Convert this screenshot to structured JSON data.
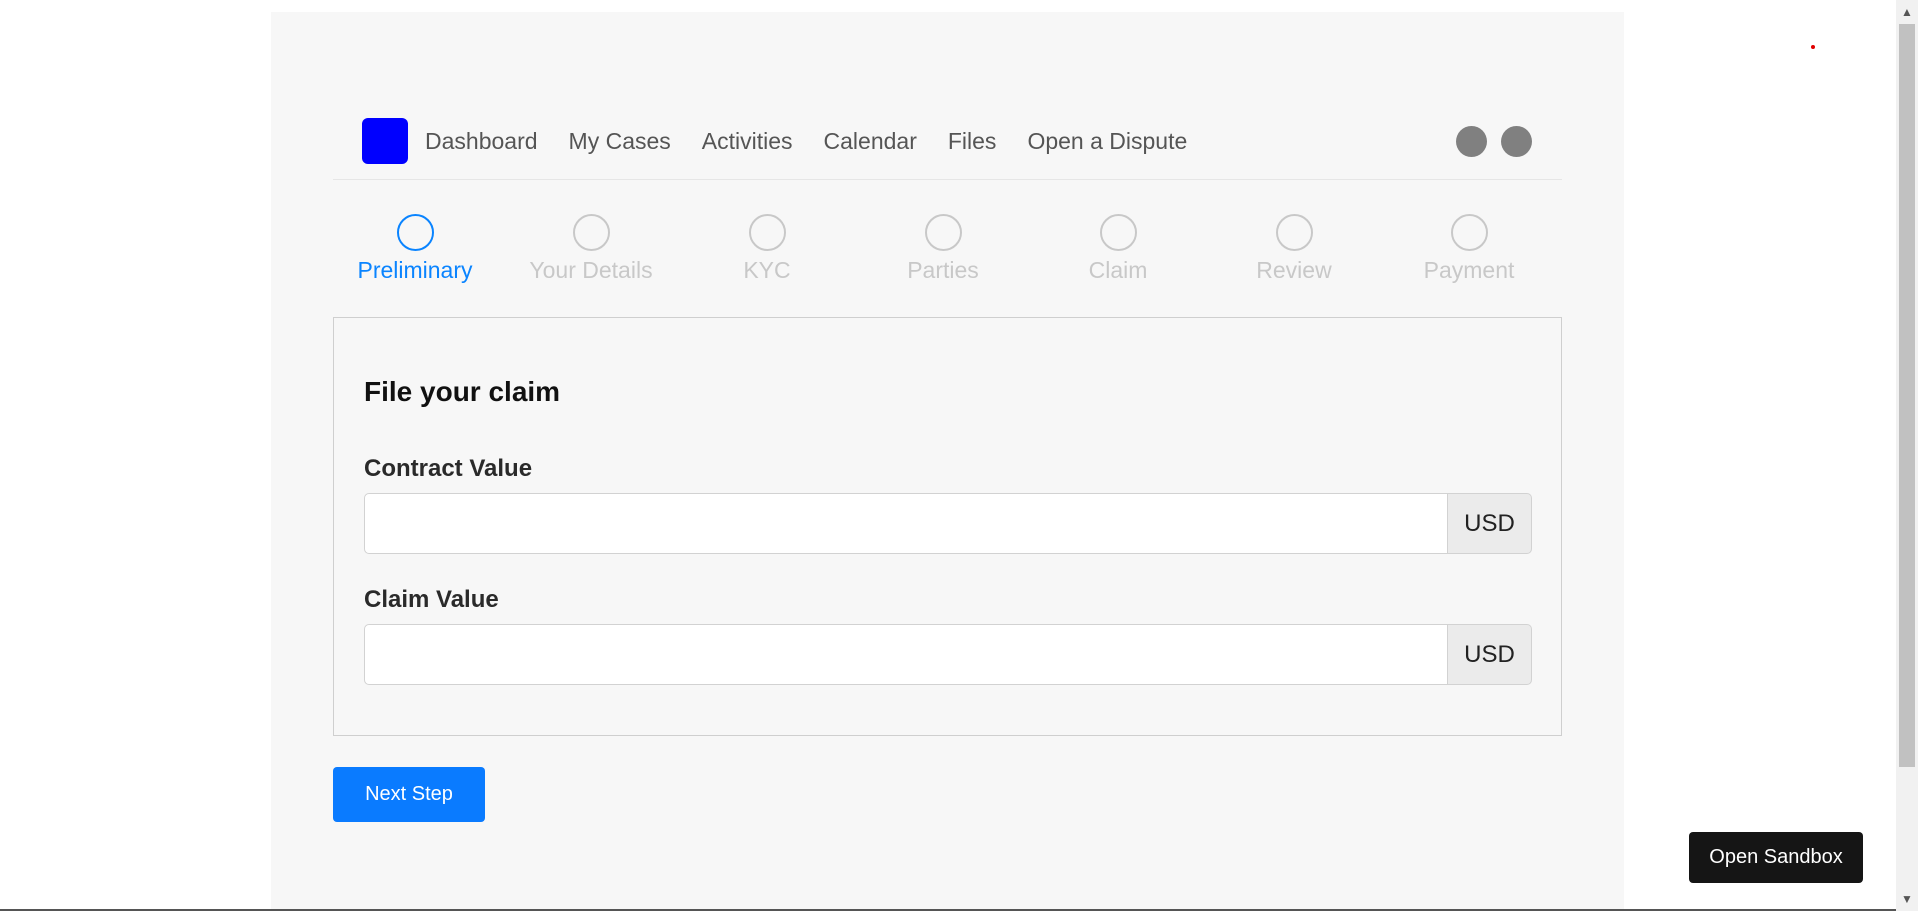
{
  "nav": {
    "items": [
      {
        "label": "Dashboard"
      },
      {
        "label": "My Cases"
      },
      {
        "label": "Activities"
      },
      {
        "label": "Calendar"
      },
      {
        "label": "Files"
      },
      {
        "label": "Open a Dispute"
      }
    ]
  },
  "stepper": {
    "steps": [
      {
        "label": "Preliminary",
        "active": true
      },
      {
        "label": "Your Details",
        "active": false
      },
      {
        "label": "KYC",
        "active": false
      },
      {
        "label": "Parties",
        "active": false
      },
      {
        "label": "Claim",
        "active": false
      },
      {
        "label": "Review",
        "active": false
      },
      {
        "label": "Payment",
        "active": false
      }
    ]
  },
  "form": {
    "title": "File your claim",
    "contract_value": {
      "label": "Contract Value",
      "value": "",
      "currency": "USD"
    },
    "claim_value": {
      "label": "Claim Value",
      "value": "",
      "currency": "USD"
    }
  },
  "buttons": {
    "next_step": "Next Step",
    "open_sandbox": "Open Sandbox"
  },
  "colors": {
    "logo": "#0000ff",
    "accent": "#0a84ff",
    "inactive_step": "#c8c8c8",
    "page_bg": "#f7f7f7"
  }
}
